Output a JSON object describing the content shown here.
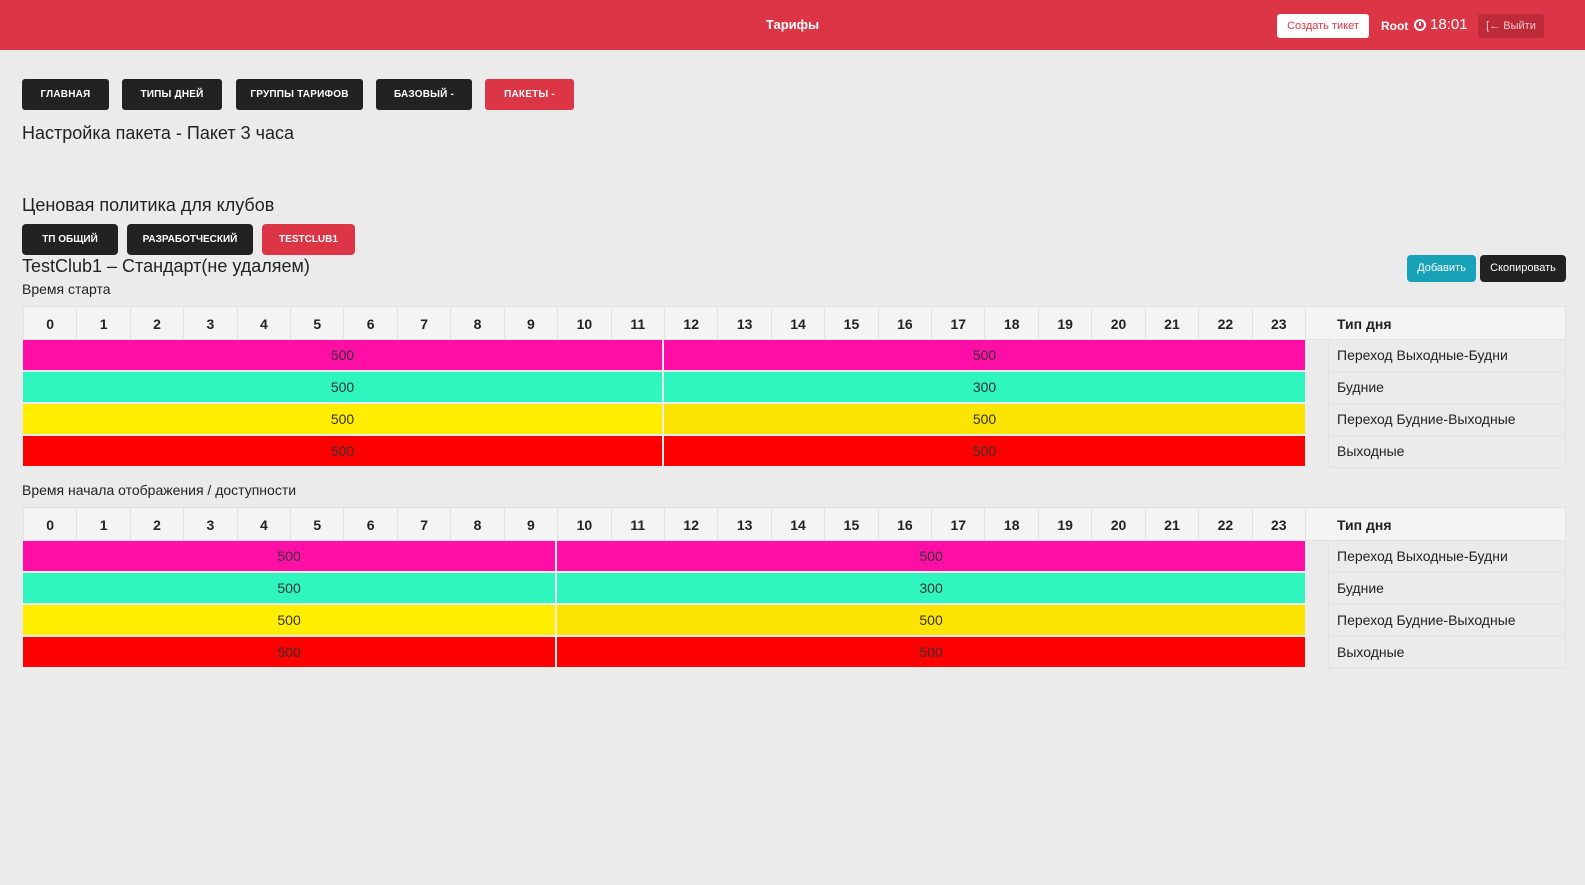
{
  "header": {
    "title": "Тарифы",
    "create_ticket": "Создать тикет",
    "user": "Root",
    "time": "18:01",
    "logout": "Выйти"
  },
  "nav": [
    {
      "label": "ГЛАВНАЯ"
    },
    {
      "label": "ТИПЫ ДНЕЙ"
    },
    {
      "label": "ГРУППЫ ТАРИФОВ"
    },
    {
      "label": "БАЗОВЫЙ -"
    },
    {
      "label": "ПАКЕТЫ -"
    }
  ],
  "package_heading": "Настройка пакета - Пакет 3 часа",
  "policy_heading": "Ценовая политика для клубов",
  "clubs": [
    {
      "label": "ТП ОБЩИЙ"
    },
    {
      "label": "РАЗРАБОТЧЕСКИЙ"
    },
    {
      "label": "TESTCLUB1"
    }
  ],
  "tariff_heading": "TestClub1 – Стандарт(не удаляем)",
  "actions": {
    "add": "Добавить",
    "copy": "Скопировать"
  },
  "day_type_header": "Тип дня",
  "colors": {
    "pink": "#ff0fa6",
    "teal": "#2ff5be",
    "yellow1": "#ffee00",
    "yellow2": "#fae400",
    "red": "#ff0000"
  },
  "grids": [
    {
      "label": "Время старта",
      "hours": [
        "0",
        "1",
        "2",
        "3",
        "4",
        "5",
        "6",
        "7",
        "8",
        "9",
        "10",
        "11",
        "12",
        "13",
        "14",
        "15",
        "16",
        "17",
        "18",
        "19",
        "20",
        "21",
        "22",
        "23"
      ],
      "rows": [
        {
          "day_type": "Переход Выходные-Будни",
          "segments": [
            {
              "value": "500",
              "from_hour": 0,
              "to_hour": 12,
              "color": "#ff0fa6"
            },
            {
              "value": "500",
              "from_hour": 12,
              "to_hour": 24,
              "color": "#ff0fa6"
            }
          ]
        },
        {
          "day_type": "Будние",
          "segments": [
            {
              "value": "500",
              "from_hour": 0,
              "to_hour": 12,
              "color": "#2ff5be"
            },
            {
              "value": "300",
              "from_hour": 12,
              "to_hour": 24,
              "color": "#2ff5be"
            }
          ]
        },
        {
          "day_type": "Переход Будние-Выходные",
          "segments": [
            {
              "value": "500",
              "from_hour": 0,
              "to_hour": 12,
              "color": "#ffee00"
            },
            {
              "value": "500",
              "from_hour": 12,
              "to_hour": 24,
              "color": "#fae400"
            }
          ]
        },
        {
          "day_type": "Выходные",
          "segments": [
            {
              "value": "500",
              "from_hour": 0,
              "to_hour": 12,
              "color": "#ff0000"
            },
            {
              "value": "500",
              "from_hour": 12,
              "to_hour": 24,
              "color": "#ff0000"
            }
          ]
        }
      ]
    },
    {
      "label": "Время начала отображения / доступности",
      "hours": [
        "0",
        "1",
        "2",
        "3",
        "4",
        "5",
        "6",
        "7",
        "8",
        "9",
        "10",
        "11",
        "12",
        "13",
        "14",
        "15",
        "16",
        "17",
        "18",
        "19",
        "20",
        "21",
        "22",
        "23"
      ],
      "rows": [
        {
          "day_type": "Переход Выходные-Будни",
          "segments": [
            {
              "value": "500",
              "from_hour": 0,
              "to_hour": 10,
              "color": "#ff0fa6"
            },
            {
              "value": "500",
              "from_hour": 10,
              "to_hour": 24,
              "color": "#ff0fa6"
            }
          ]
        },
        {
          "day_type": "Будние",
          "segments": [
            {
              "value": "500",
              "from_hour": 0,
              "to_hour": 10,
              "color": "#2ff5be"
            },
            {
              "value": "300",
              "from_hour": 10,
              "to_hour": 24,
              "color": "#2ff5be"
            }
          ]
        },
        {
          "day_type": "Переход Будние-Выходные",
          "segments": [
            {
              "value": "500",
              "from_hour": 0,
              "to_hour": 10,
              "color": "#ffee00"
            },
            {
              "value": "500",
              "from_hour": 10,
              "to_hour": 24,
              "color": "#fae400"
            }
          ]
        },
        {
          "day_type": "Выходные",
          "segments": [
            {
              "value": "500",
              "from_hour": 0,
              "to_hour": 10,
              "color": "#ff0000"
            },
            {
              "value": "500",
              "from_hour": 10,
              "to_hour": 24,
              "color": "#ff0000"
            }
          ]
        }
      ]
    }
  ]
}
